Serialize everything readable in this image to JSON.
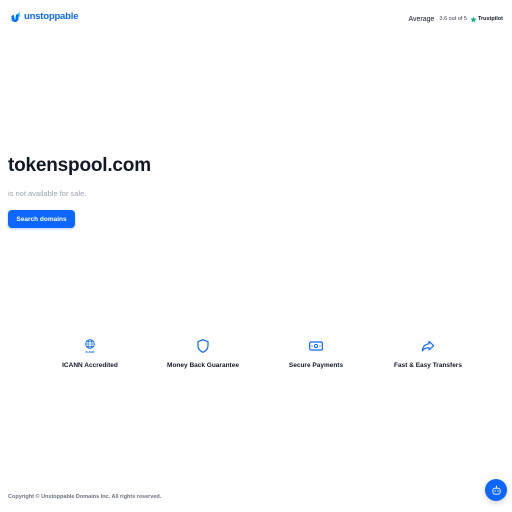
{
  "header": {
    "logo_text": "unstoppable",
    "rating": {
      "label": "Average",
      "score_text": "3.6 out of 5",
      "provider": "Trustpilot"
    }
  },
  "hero": {
    "domain": "tokenspool.com",
    "status": "is not available for sale.",
    "search_label": "Search domains"
  },
  "features": [
    {
      "label": "ICANN Accredited",
      "icon": "icann-globe-icon",
      "icon_caption": "ICANN"
    },
    {
      "label": "Money Back Guarantee",
      "icon": "shield-icon"
    },
    {
      "label": "Secure Payments",
      "icon": "payment-icon"
    },
    {
      "label": "Fast & Easy Transfers",
      "icon": "forward-arrow-icon"
    }
  ],
  "footer": {
    "copyright": "Copyright © Unstoppable Domains Inc. All rights reserved."
  },
  "colors": {
    "brand": "#0d67fe",
    "text": "#111827",
    "muted": "#9ca3af",
    "trustpilot_green": "#00b67a"
  }
}
